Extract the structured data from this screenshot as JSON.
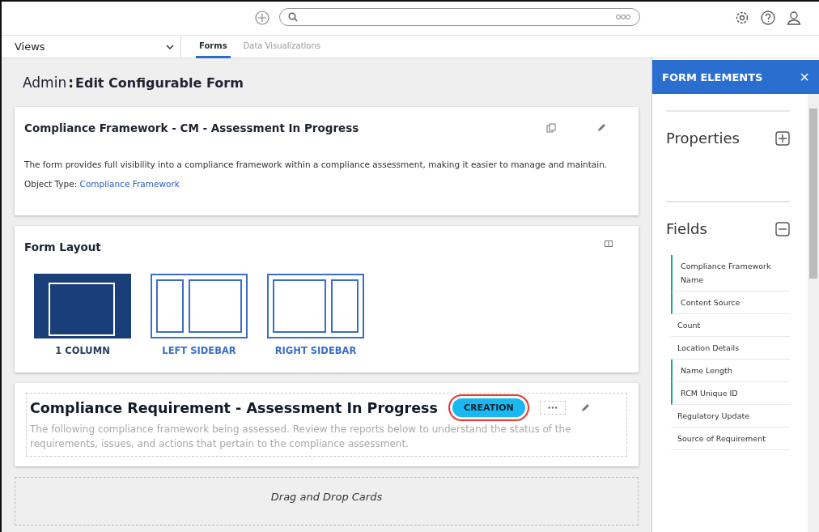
{
  "nav": {
    "views_label": "Views",
    "tabs": [
      {
        "label": "Forms",
        "selected": true
      },
      {
        "label": "Data Visualizations",
        "selected": false
      }
    ]
  },
  "page": {
    "breadcrumb": "Admin",
    "separator": ":",
    "title": "Edit Configurable Form"
  },
  "form_card": {
    "title": "Compliance Framework - CM - Assessment In Progress",
    "description": "The form provides full visibility into a compliance framework within a compliance assessment, making it easier to manage and maintain.",
    "object_type_label": "Object Type:",
    "object_type": "Compliance Framework"
  },
  "layout_card": {
    "title": "Form Layout",
    "options": [
      {
        "kind": "one_column",
        "label": "1 COLUMN",
        "selected": true
      },
      {
        "kind": "left_sidebar",
        "label": "LEFT SIDEBAR",
        "selected": false
      },
      {
        "kind": "right_sidebar",
        "label": "RIGHT SIDEBAR",
        "selected": false
      }
    ]
  },
  "section": {
    "title": "Compliance Requirement - Assessment In Progress",
    "badge": "CREATION",
    "description": "The following compliance framework being assessed. Review the reports below to understand the status of the requirements, issues, and actions that pertain to the compliance assessment."
  },
  "dropzone": {
    "label": "Drag and Drop Cards"
  },
  "panel": {
    "title": "FORM ELEMENTS",
    "close": "×",
    "groups": [
      {
        "title": "Properties",
        "expanded": false
      },
      {
        "title": "Fields",
        "expanded": true
      }
    ],
    "fields": [
      {
        "label": "Compliance Framework Name",
        "in_form": true
      },
      {
        "label": "Content Source",
        "in_form": true
      },
      {
        "label": "Count",
        "in_form": false
      },
      {
        "label": "Location Details",
        "in_form": false
      },
      {
        "label": "Name Length",
        "in_form": true
      },
      {
        "label": "RCM Unique ID",
        "in_form": true
      },
      {
        "label": "Regulatory Update",
        "in_form": false
      },
      {
        "label": "Source of Requirement",
        "in_form": false
      }
    ]
  }
}
